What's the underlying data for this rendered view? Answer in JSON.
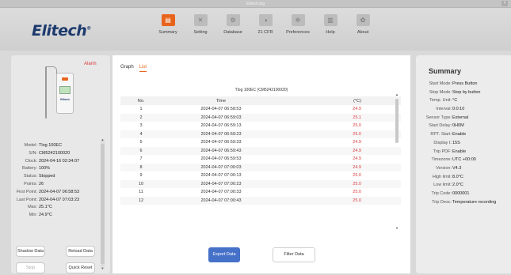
{
  "window": {
    "title": "Elitech.log"
  },
  "brand": {
    "logo_text": "Elitech",
    "logo_mark": "®"
  },
  "nav": [
    {
      "label": "Summary",
      "icon": "summary-icon",
      "glyph": "▤"
    },
    {
      "label": "Setting",
      "icon": "tools-icon",
      "glyph": "✕"
    },
    {
      "label": "Database",
      "icon": "database-icon",
      "glyph": "⚙"
    },
    {
      "label": "21 CFR",
      "icon": "cfr-icon",
      "glyph": "◑"
    },
    {
      "label": "Preferences",
      "icon": "preferences-icon",
      "glyph": "✲"
    },
    {
      "label": "Help",
      "icon": "help-icon",
      "glyph": "▥"
    },
    {
      "label": "About",
      "icon": "about-icon",
      "glyph": "✿"
    }
  ],
  "device": {
    "alarm_label": "Alarm",
    "brand_on_device": "Elitech",
    "info": [
      {
        "key": "Model:",
        "value": "Tlog 100EC"
      },
      {
        "key": "S/N:",
        "value": "CM5242100020"
      },
      {
        "key": "Clock:",
        "value": "2024-04-16 02:34:07"
      },
      {
        "key": "Battery:",
        "value": "100%"
      },
      {
        "key": "Status:",
        "value": "Stopped"
      },
      {
        "key": "Points:",
        "value": "26"
      },
      {
        "key": "First Point:",
        "value": "2024-04-07 06:58:53"
      },
      {
        "key": "Last Point:",
        "value": "2024-04-07 07:03:23"
      },
      {
        "key": "Max:",
        "value": "25.1°C"
      },
      {
        "key": "Min:",
        "value": "24.9°C"
      }
    ],
    "buttons": {
      "shadow_data": "Shadow Data",
      "reload_data": "Reload Data",
      "stop": "Stop",
      "quick_reset": "Quick Reset"
    }
  },
  "main": {
    "tabs": [
      {
        "label": "Graph"
      },
      {
        "label": "List"
      }
    ],
    "active_tab": "List",
    "table": {
      "caption": "Tlog 100EC (CM5242100020)",
      "columns": {
        "no": "No.",
        "time": "Time",
        "value": "(°C)"
      },
      "rows": [
        {
          "no": "1",
          "time": "2024-04-07 06:58:53",
          "value": "24.9"
        },
        {
          "no": "2",
          "time": "2024-04-07 06:59:03",
          "value": "25.1"
        },
        {
          "no": "3",
          "time": "2024-04-07 06:59:13",
          "value": "25.0"
        },
        {
          "no": "4",
          "time": "2024-04-07 06:59:23",
          "value": "25.0"
        },
        {
          "no": "5",
          "time": "2024-04-07 06:59:33",
          "value": "24.9"
        },
        {
          "no": "6",
          "time": "2024-04-07 06:59:43",
          "value": "24.9"
        },
        {
          "no": "7",
          "time": "2024-04-07 06:59:53",
          "value": "24.9"
        },
        {
          "no": "8",
          "time": "2024-04-07 07:00:03",
          "value": "24.9"
        },
        {
          "no": "9",
          "time": "2024-04-07 07:00:13",
          "value": "25.0"
        },
        {
          "no": "10",
          "time": "2024-04-07 07:00:23",
          "value": "25.0"
        },
        {
          "no": "11",
          "time": "2024-04-07 07:00:33",
          "value": "25.0"
        },
        {
          "no": "12",
          "time": "2024-04-07 07:00:43",
          "value": "25.0"
        }
      ]
    },
    "buttons": {
      "export": "Export Data",
      "filter": "Filter Data"
    }
  },
  "summary": {
    "title": "Summary",
    "items": [
      {
        "key": "Start Mode:",
        "value": "Press Button"
      },
      {
        "key": "Stop Mode:",
        "value": "Stop by button"
      },
      {
        "key": "Temp. Unit:",
        "value": "°C"
      },
      {
        "key": "Interval:",
        "value": "0:0:10"
      },
      {
        "key": "Sensor Type:",
        "value": "External"
      },
      {
        "key": "Start Delay:",
        "value": "0H0M"
      },
      {
        "key": "RPT. Start:",
        "value": "Enable"
      },
      {
        "key": "Display t:",
        "value": "15S"
      },
      {
        "key": "Trip PDF:",
        "value": "Enable"
      },
      {
        "key": "Timezone:",
        "value": "UTC +00:00"
      },
      {
        "key": "Version:",
        "value": "V4.3"
      },
      {
        "key": "High limit:",
        "value": "8.0°C"
      },
      {
        "key": "Low limit:",
        "value": "2.0°C"
      },
      {
        "key": "Trip Code:",
        "value": "0000001"
      },
      {
        "key": "Trip Desc:",
        "value": "Temperature recording"
      }
    ]
  },
  "colors": {
    "accent": "#e8641d",
    "alarm": "#d93b3b",
    "primary_button": "#4671c9",
    "logo": "#1d3a6e"
  }
}
